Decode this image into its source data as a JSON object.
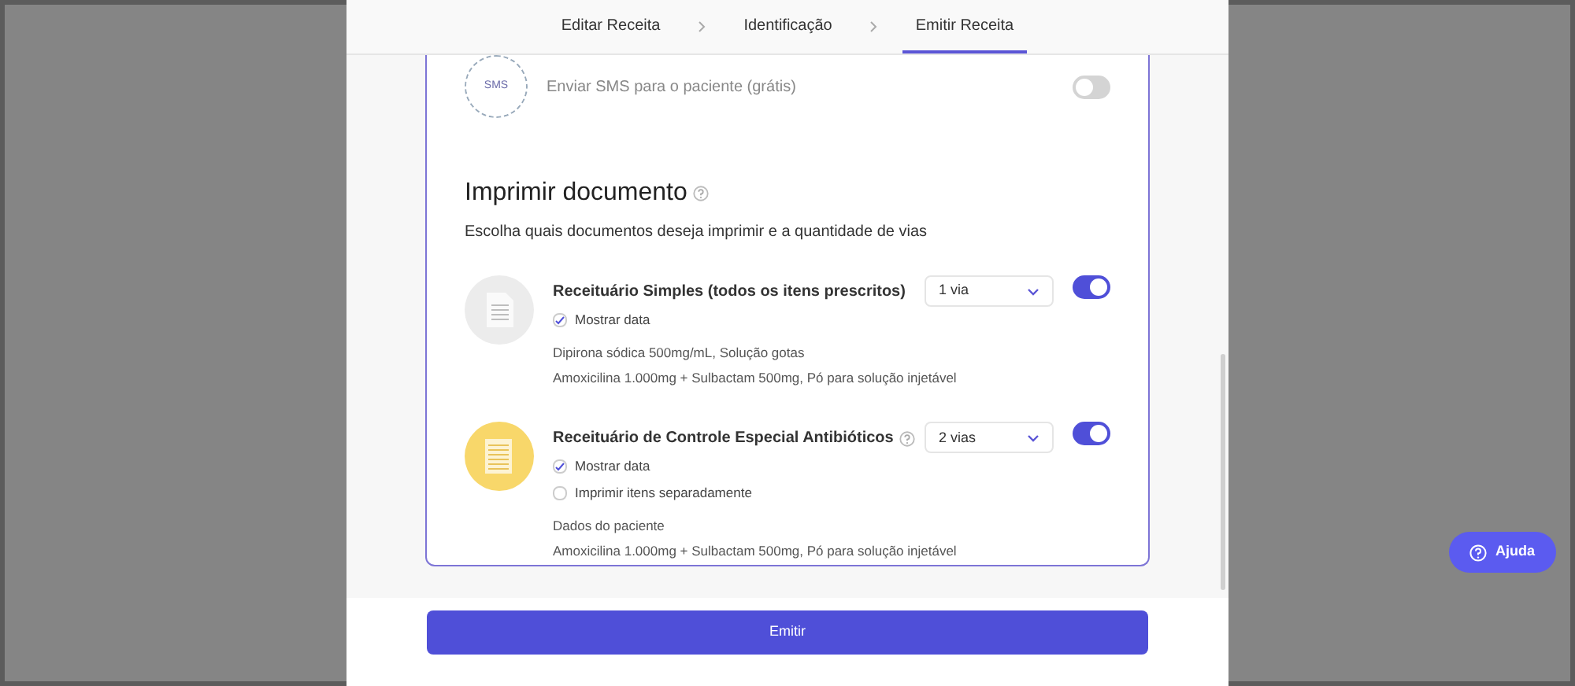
{
  "steps": [
    {
      "label": "Editar Receita",
      "selected": false
    },
    {
      "label": "Identificação",
      "selected": false
    },
    {
      "label": "Emitir Receita",
      "selected": true
    }
  ],
  "sms": {
    "icon_label": "SMS",
    "label": "Enviar SMS para o paciente (grátis)",
    "on": false
  },
  "print": {
    "title": "Imprimir documento",
    "subtitle": "Escolha quais documentos deseja imprimir e a quantidade de vias",
    "documents": [
      {
        "kind": "simple",
        "title": "Receituário Simples (todos os itens prescritos)",
        "help": false,
        "copies": "1 via",
        "on": true,
        "options": [
          {
            "label": "Mostrar data",
            "checked": true
          }
        ],
        "lines": [
          "Dipirona sódica 500mg/mL, Solução gotas",
          "Amoxicilina 1.000mg + Sulbactam 500mg, Pó para solução injetável"
        ]
      },
      {
        "kind": "special",
        "title": "Receituário de Controle Especial Antibióticos",
        "help": true,
        "copies": "2 vias",
        "on": true,
        "options": [
          {
            "label": "Mostrar data",
            "checked": true
          },
          {
            "label": "Imprimir itens separadamente",
            "checked": false
          }
        ],
        "lines": [
          "Dados do paciente",
          "Amoxicilina 1.000mg + Sulbactam 500mg, Pó para solução injetável"
        ]
      }
    ]
  },
  "submit": "Emitir",
  "help_button": "Ajuda"
}
